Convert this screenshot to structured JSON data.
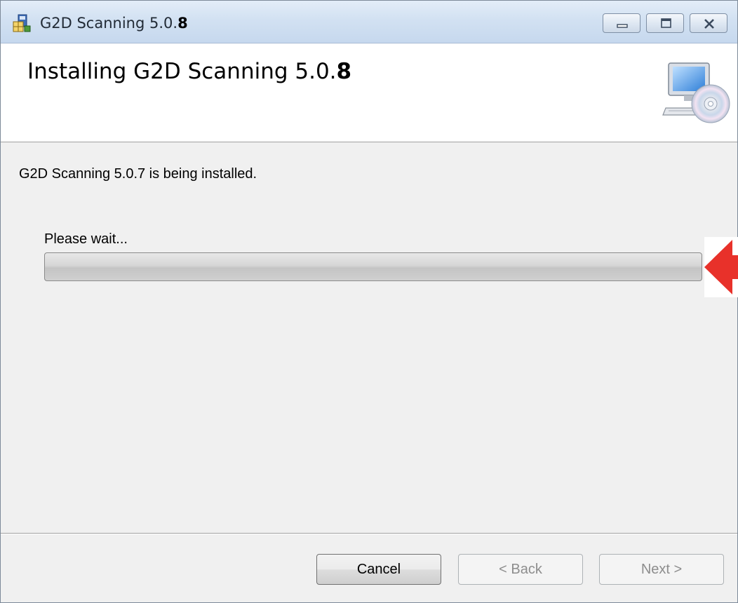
{
  "window": {
    "title_main": "G2D Scanning 5.0.",
    "title_suffix": "8",
    "icon": "installer-package-icon"
  },
  "title_buttons": {
    "minimize_icon": "minimize-icon",
    "maximize_icon": "maximize-icon",
    "close_icon": "close-icon"
  },
  "banner": {
    "title_main": "Installing G2D Scanning 5.0.",
    "title_suffix": "8",
    "icon": "computer-cd-icon"
  },
  "body": {
    "status_text": "G2D Scanning 5.0.7 is being installed.",
    "wait_label": "Please wait...",
    "progress": 0
  },
  "callout": {
    "icon": "red-arrow-icon"
  },
  "footer": {
    "cancel_label": "Cancel",
    "back_label": "< Back",
    "next_label": "Next >"
  },
  "colors": {
    "titlebar": "#d2e1f2",
    "dialog_bg": "#f0f0f0",
    "callout_arrow": "#e8312a",
    "disabled_text": "#8d8d8d"
  }
}
